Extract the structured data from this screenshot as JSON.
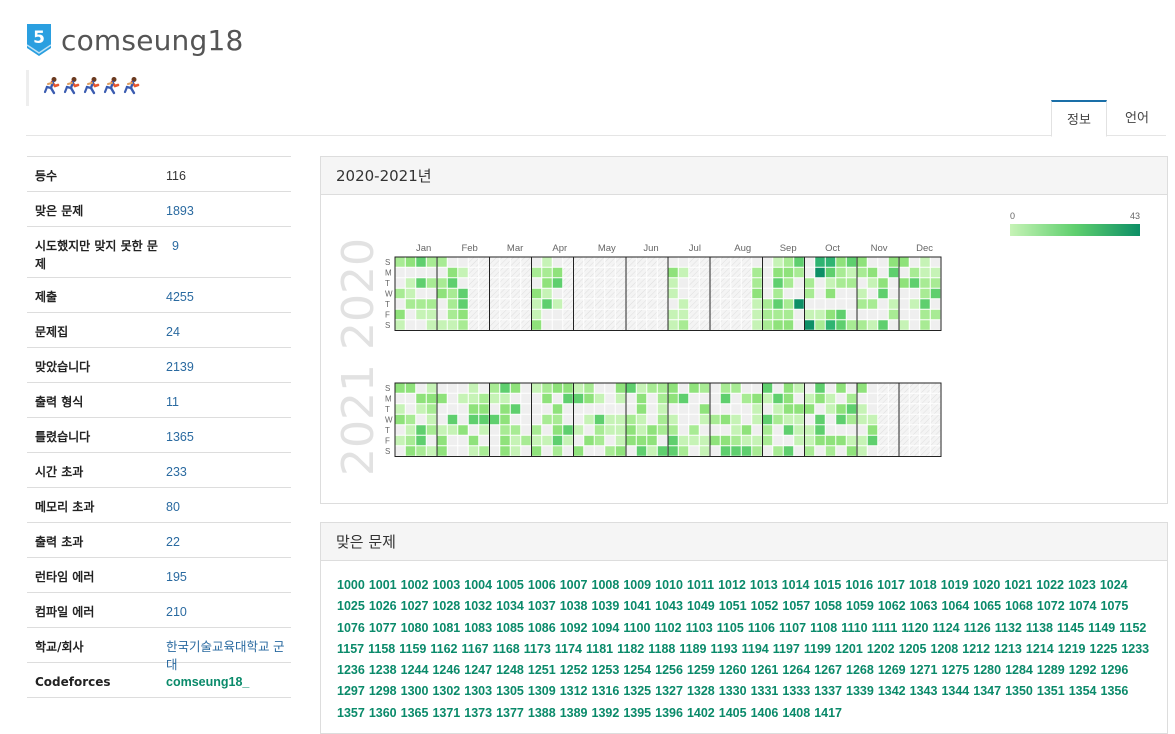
{
  "header": {
    "tier_badge_text": "5",
    "tier_color": "#2a9fe0",
    "username": "comseung18",
    "status_icon": "running-person-icon",
    "status_count": 5
  },
  "tabs": [
    {
      "label": "정보",
      "active": true
    },
    {
      "label": "언어",
      "active": false
    }
  ],
  "info": [
    {
      "label": "등수",
      "value": "116",
      "link": false
    },
    {
      "label": "맞은 문제",
      "value": "1893",
      "link": true
    },
    {
      "label": "시도했지만 맞지 못한 문제",
      "value": "9",
      "link": true
    },
    {
      "label": "제출",
      "value": "4255",
      "link": true
    },
    {
      "label": "문제집",
      "value": "24",
      "link": true
    },
    {
      "label": "맞았습니다",
      "value": "2139",
      "link": true
    },
    {
      "label": "출력 형식",
      "value": "11",
      "link": true
    },
    {
      "label": "틀렸습니다",
      "value": "1365",
      "link": true
    },
    {
      "label": "시간 초과",
      "value": "233",
      "link": true
    },
    {
      "label": "메모리 초과",
      "value": "80",
      "link": true
    },
    {
      "label": "출력 초과",
      "value": "22",
      "link": true
    },
    {
      "label": "런타임 에러",
      "value": "195",
      "link": true
    },
    {
      "label": "컴파일 에러",
      "value": "210",
      "link": true
    },
    {
      "label": "학교/회사",
      "value": "한국기술교육대학교 군대",
      "link": true
    },
    {
      "label": "Codeforces",
      "value": "comseung18_",
      "link": true,
      "green": true
    }
  ],
  "heatmap": {
    "title": "2020-2021년",
    "legend_min": "0",
    "legend_max": "43",
    "colors": {
      "empty": "#efefef",
      "c1": "#c6f3b6",
      "c2": "#a8eb94",
      "c3": "#8fe27b",
      "c4": "#5fcf6e",
      "c5": "#2fb472",
      "c6": "#0d8f66"
    },
    "years": [
      "2020",
      "2021"
    ],
    "months": [
      "Jan",
      "Feb",
      "Mar",
      "Apr",
      "May",
      "Jun",
      "Jul",
      "Aug",
      "Sep",
      "Oct",
      "Nov",
      "Dec"
    ],
    "weekdays": [
      "S",
      "M",
      "T",
      "W",
      "T",
      "F",
      "S"
    ]
  },
  "solved": {
    "title": "맞은 문제",
    "problems": [
      "1000",
      "1001",
      "1002",
      "1003",
      "1004",
      "1005",
      "1006",
      "1007",
      "1008",
      "1009",
      "1010",
      "1011",
      "1012",
      "1013",
      "1014",
      "1015",
      "1016",
      "1017",
      "1018",
      "1019",
      "1020",
      "1021",
      "1022",
      "1023",
      "1024",
      "1025",
      "1026",
      "1027",
      "1028",
      "1032",
      "1034",
      "1037",
      "1038",
      "1039",
      "1041",
      "1043",
      "1049",
      "1051",
      "1052",
      "1057",
      "1058",
      "1059",
      "1062",
      "1063",
      "1064",
      "1065",
      "1068",
      "1072",
      "1074",
      "1075",
      "1076",
      "1077",
      "1080",
      "1081",
      "1083",
      "1085",
      "1086",
      "1092",
      "1094",
      "1100",
      "1102",
      "1103",
      "1105",
      "1106",
      "1107",
      "1108",
      "1110",
      "1111",
      "1120",
      "1124",
      "1126",
      "1132",
      "1138",
      "1145",
      "1149",
      "1152",
      "1157",
      "1158",
      "1159",
      "1162",
      "1167",
      "1168",
      "1173",
      "1174",
      "1181",
      "1182",
      "1188",
      "1189",
      "1193",
      "1194",
      "1197",
      "1199",
      "1201",
      "1202",
      "1205",
      "1208",
      "1212",
      "1213",
      "1214",
      "1219",
      "1225",
      "1233",
      "1236",
      "1238",
      "1244",
      "1246",
      "1247",
      "1248",
      "1251",
      "1252",
      "1253",
      "1254",
      "1256",
      "1259",
      "1260",
      "1261",
      "1264",
      "1267",
      "1268",
      "1269",
      "1271",
      "1275",
      "1280",
      "1284",
      "1289",
      "1292",
      "1296",
      "1297",
      "1298",
      "1300",
      "1302",
      "1303",
      "1305",
      "1309",
      "1312",
      "1316",
      "1325",
      "1327",
      "1328",
      "1330",
      "1331",
      "1333",
      "1337",
      "1339",
      "1342",
      "1343",
      "1344",
      "1347",
      "1350",
      "1351",
      "1354",
      "1356",
      "1357",
      "1360",
      "1365",
      "1371",
      "1373",
      "1377",
      "1388",
      "1389",
      "1392",
      "1395",
      "1396",
      "1402",
      "1405",
      "1406",
      "1408",
      "1417"
    ]
  }
}
